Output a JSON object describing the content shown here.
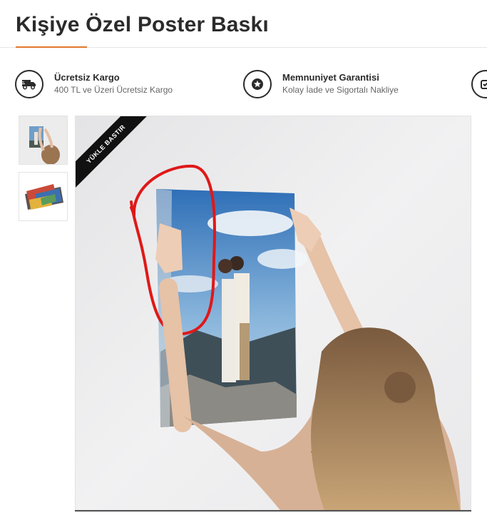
{
  "page": {
    "title": "Kişiye Özel Poster Baskı"
  },
  "features": [
    {
      "icon": "truck-icon",
      "title": "Ücretsiz Kargo",
      "subtitle": "400 TL ve Üzeri Ücretsiz Kargo"
    },
    {
      "icon": "star-badge-icon",
      "title": "Memnuniyet Garantisi",
      "subtitle": "Kolay İade ve Sigortalı Nakliye"
    },
    {
      "icon": "secure-icon",
      "title": "",
      "subtitle": ""
    }
  ],
  "gallery": {
    "ribbon_label": "YÜKLE BASTIR",
    "thumbnails": [
      "thumbnail-woman-hanging-poster",
      "thumbnail-poster-stack"
    ],
    "selected_index": 0
  },
  "colors": {
    "accent": "#e0772a",
    "text_dark": "#2b2b2b",
    "ribbon": "#111111",
    "annotation_red": "#e01818"
  }
}
